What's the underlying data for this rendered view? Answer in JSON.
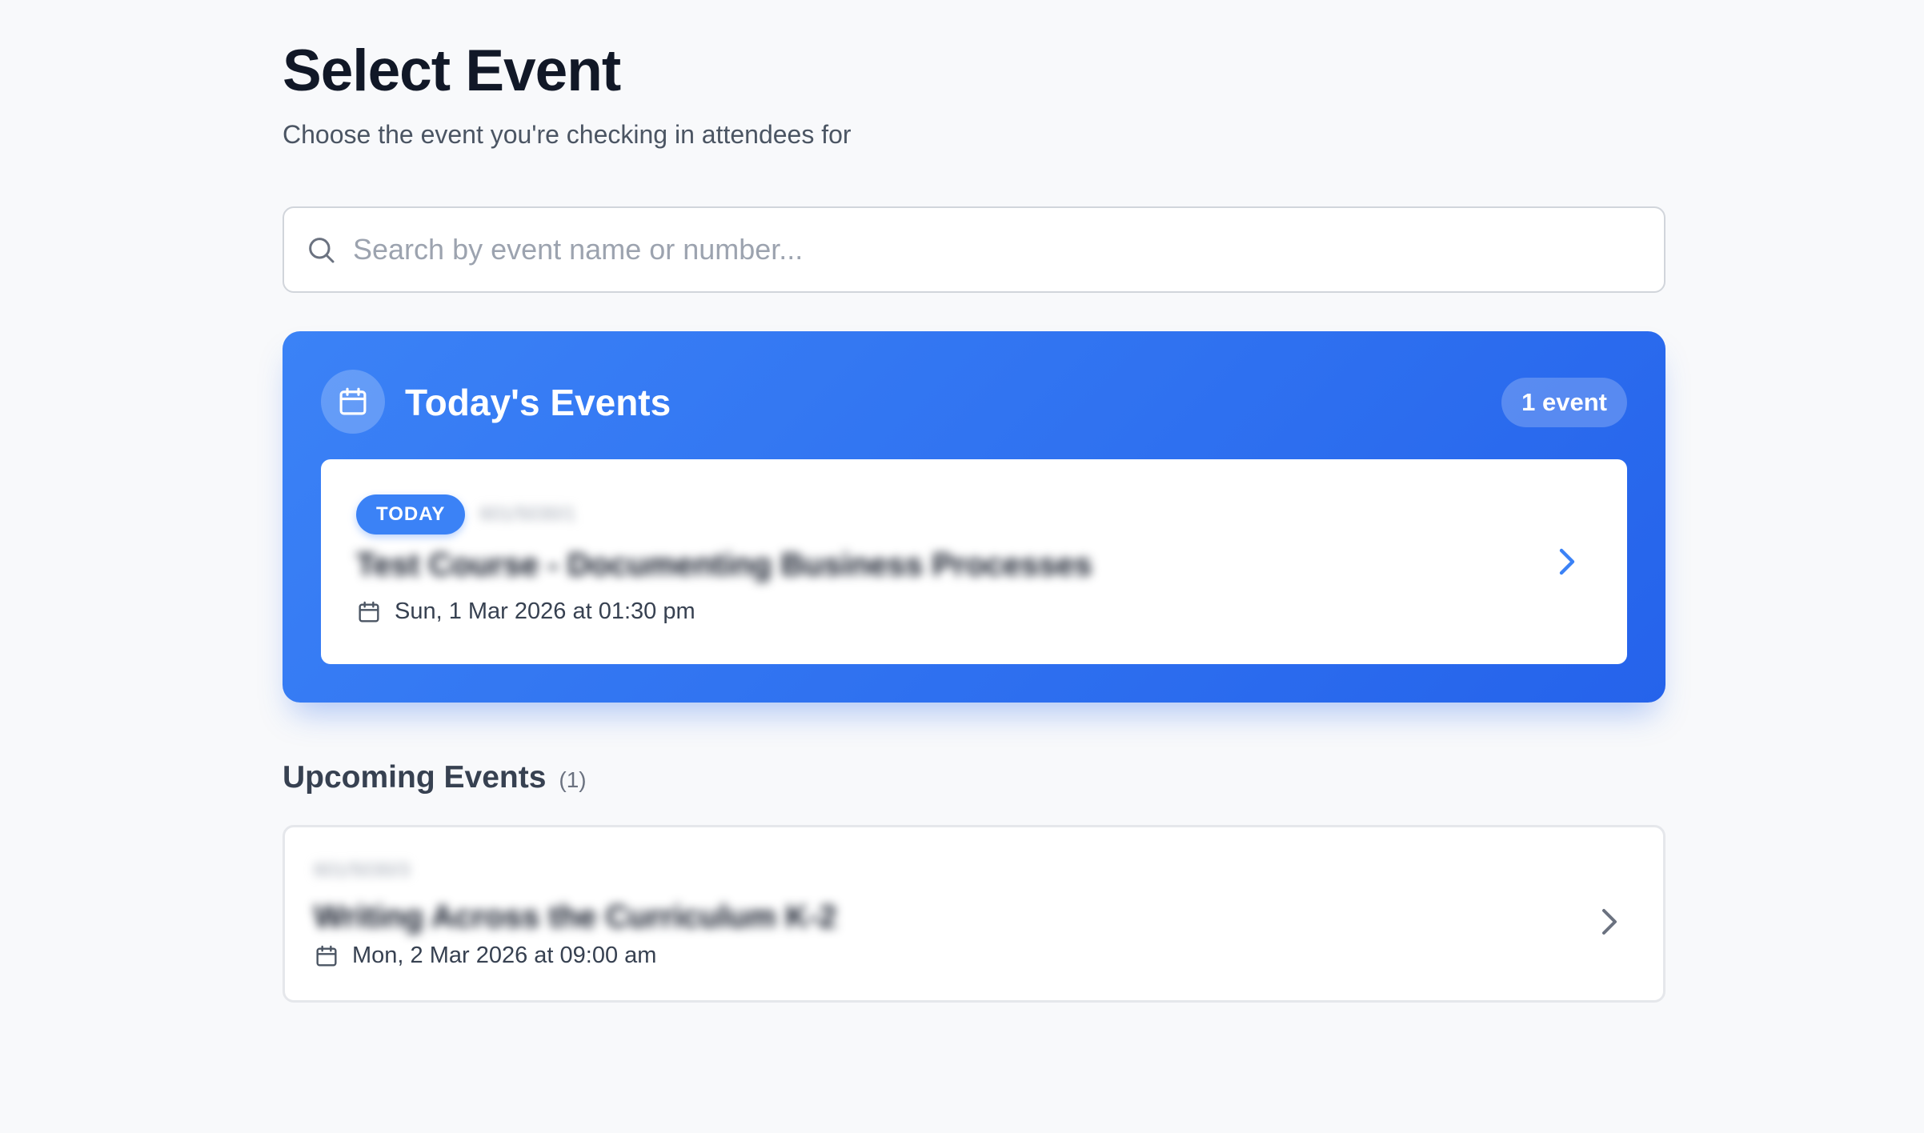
{
  "page": {
    "title": "Select Event",
    "subtitle": "Choose the event you're checking in attendees for"
  },
  "search": {
    "placeholder": "Search by event name or number...",
    "icon": "search-icon"
  },
  "today": {
    "title": "Today's Events",
    "count_label": "1 event",
    "icon": "calendar-icon",
    "events": [
      {
        "badge": "TODAY",
        "number": "601/5030/1",
        "name": "Test Course - Documenting Business Processes",
        "date": "Sun, 1 Mar 2026 at 01:30 pm"
      }
    ]
  },
  "upcoming": {
    "title": "Upcoming Events",
    "count": "(1)",
    "events": [
      {
        "number": "601/5030/3",
        "name": "Writing Across the Curriculum K-2",
        "date": "Mon, 2 Mar 2026 at 09:00 am"
      }
    ]
  },
  "colors": {
    "accent": "#3b82f6",
    "accent_dark": "#2563eb",
    "background": "#f8f9fb"
  }
}
